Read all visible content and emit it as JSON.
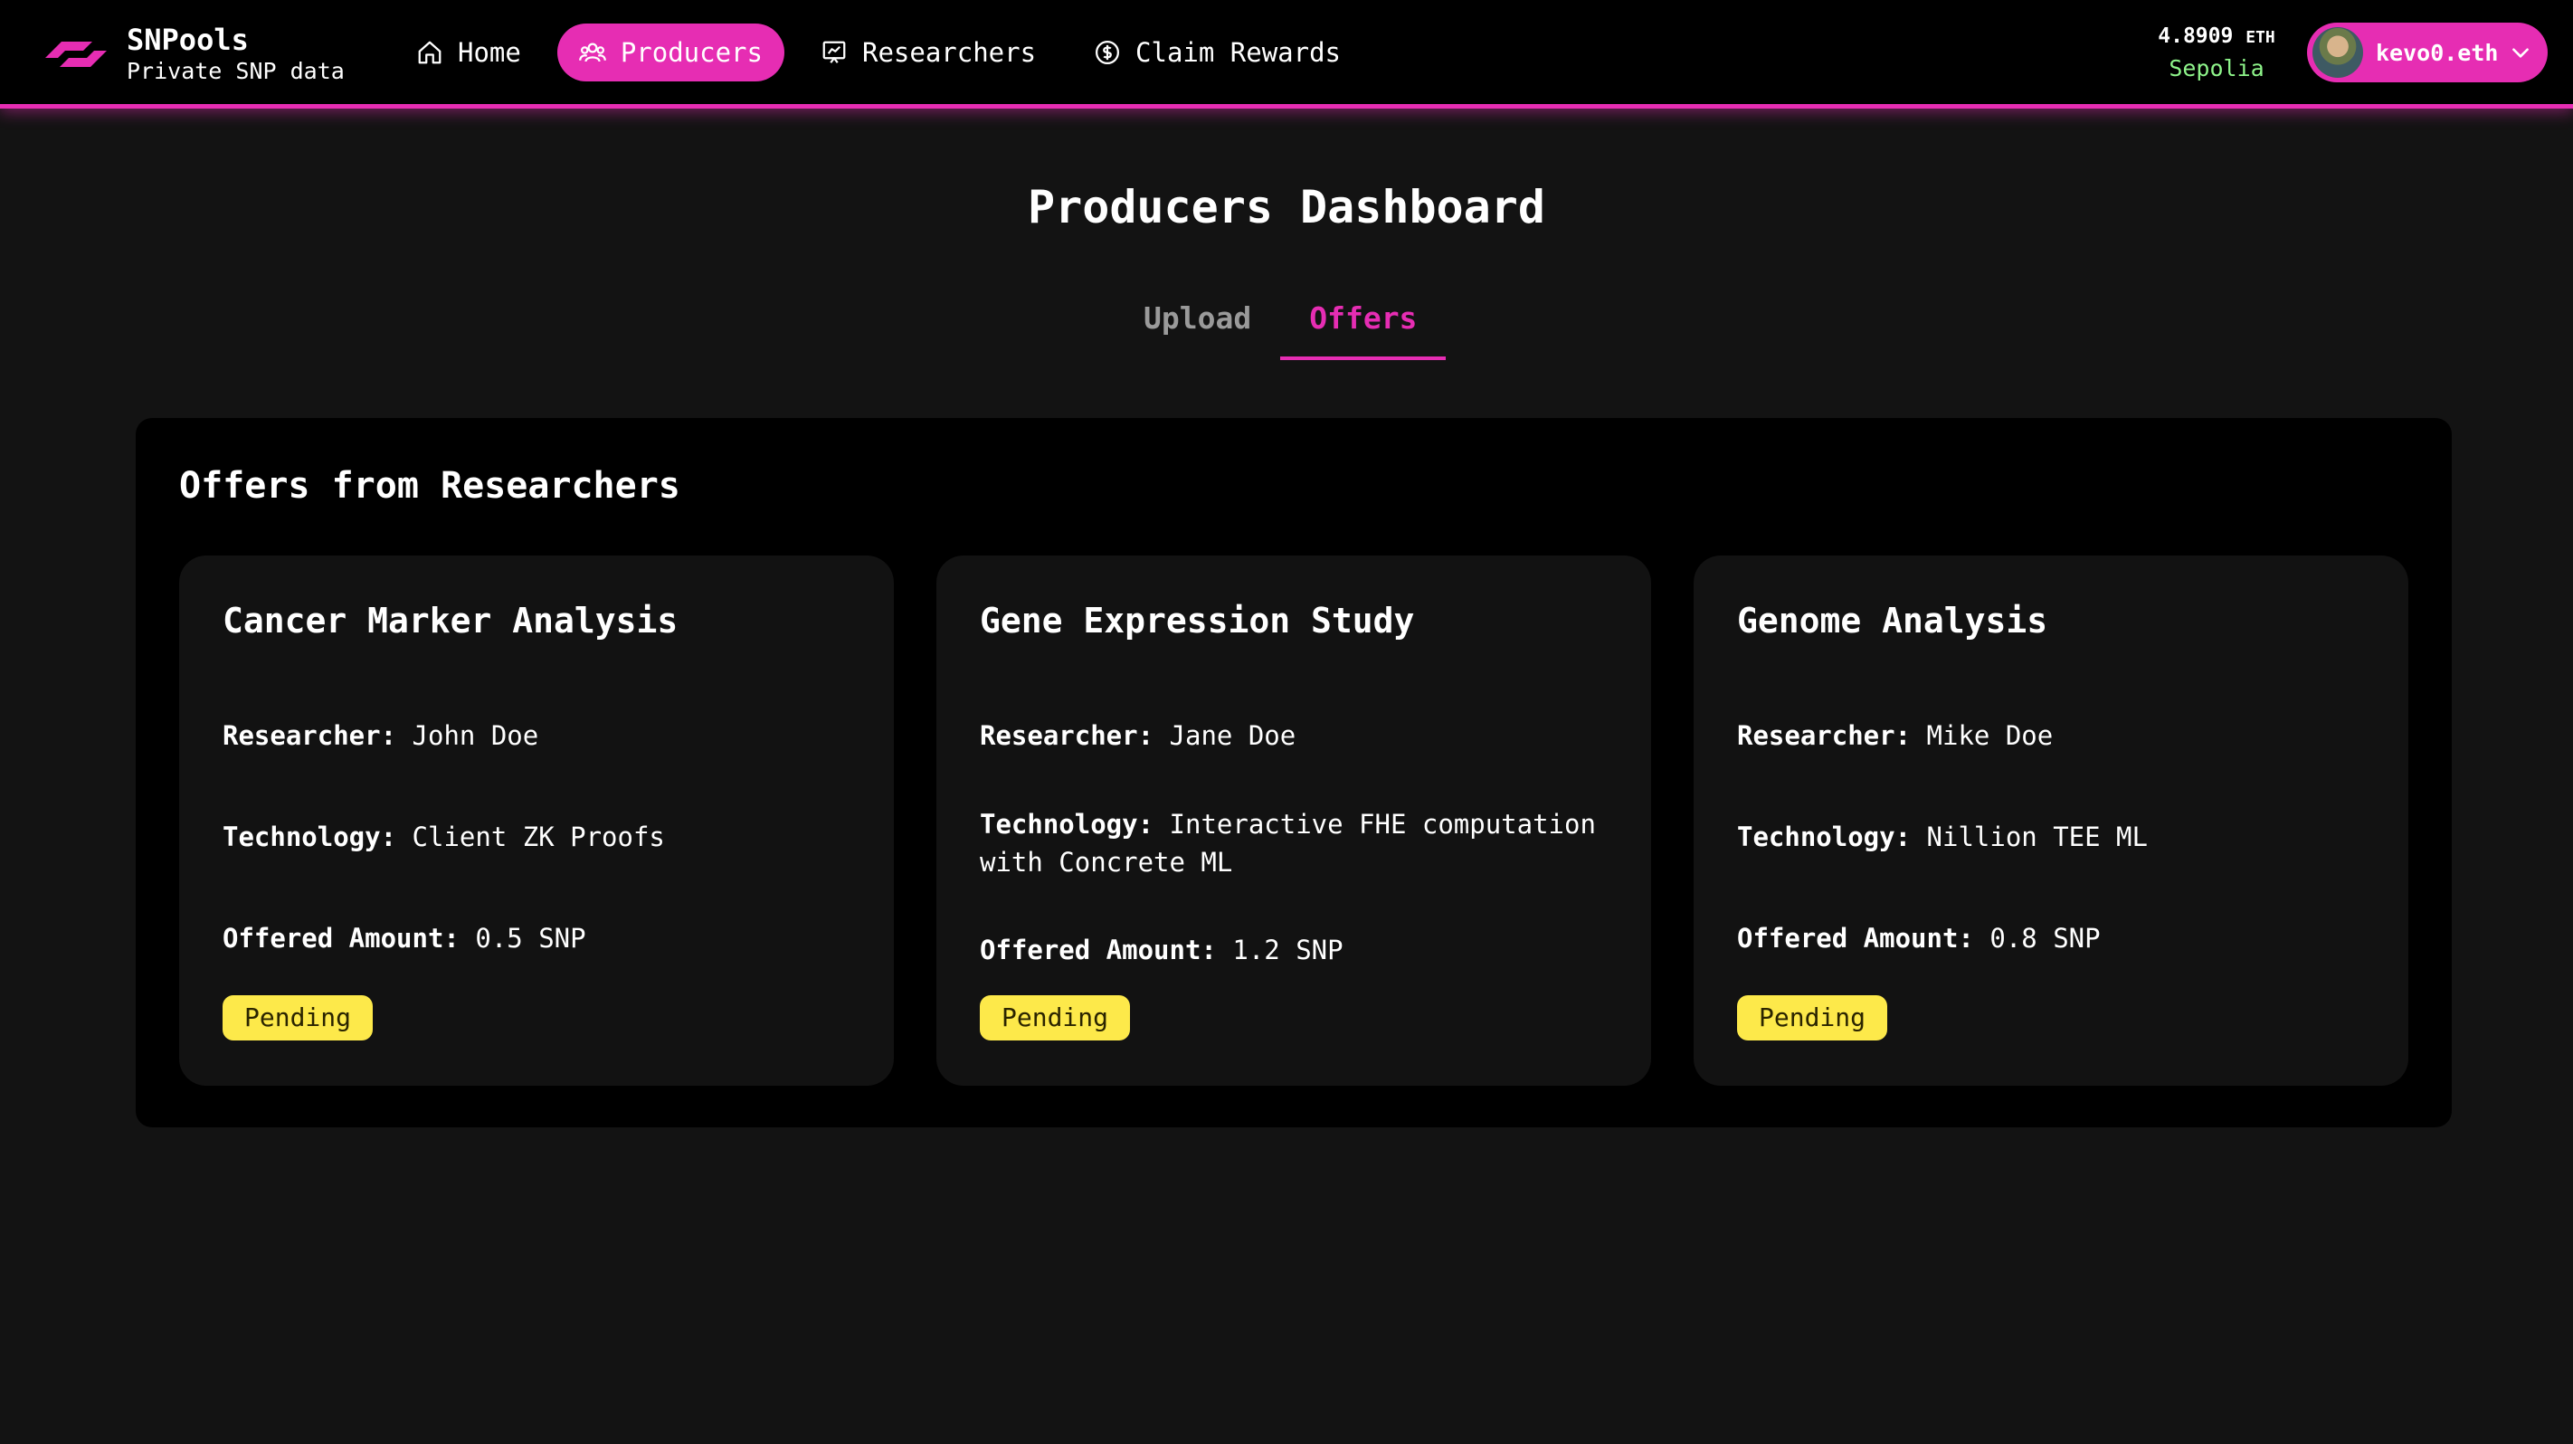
{
  "brand": {
    "name": "SNPools",
    "tagline": "Private SNP data"
  },
  "nav": {
    "items": [
      {
        "label": "Home",
        "icon": "home-icon",
        "active": false
      },
      {
        "label": "Producers",
        "icon": "users-icon",
        "active": true
      },
      {
        "label": "Researchers",
        "icon": "chart-icon",
        "active": false
      },
      {
        "label": "Claim Rewards",
        "icon": "dollar-circle-icon",
        "active": false
      }
    ]
  },
  "wallet": {
    "balance": "4.8909",
    "unit": "ETH",
    "network": "Sepolia",
    "account": "kevo0.eth"
  },
  "page": {
    "title": "Producers Dashboard",
    "tabs": [
      {
        "label": "Upload",
        "active": false
      },
      {
        "label": "Offers",
        "active": true
      }
    ]
  },
  "offers": {
    "heading": "Offers from Researchers",
    "researcher_label": "Researcher:",
    "technology_label": "Technology:",
    "amount_label": "Offered Amount:",
    "items": [
      {
        "title": "Cancer Marker Analysis",
        "researcher": "John Doe",
        "technology": "Client ZK Proofs",
        "amount": "0.5 SNP",
        "status": "Pending"
      },
      {
        "title": "Gene Expression Study",
        "researcher": "Jane Doe",
        "technology": "Interactive FHE computation with Concrete ML",
        "amount": "1.2 SNP",
        "status": "Pending"
      },
      {
        "title": "Genome Analysis",
        "researcher": "Mike Doe",
        "technology": "Nillion TEE ML",
        "amount": "0.8 SNP",
        "status": "Pending"
      }
    ]
  },
  "colors": {
    "accent": "#e62db3",
    "background": "#131313",
    "panel": "#000000",
    "card": "#121212",
    "network": "#8ef48a",
    "pending_badge": "#fde94a"
  }
}
